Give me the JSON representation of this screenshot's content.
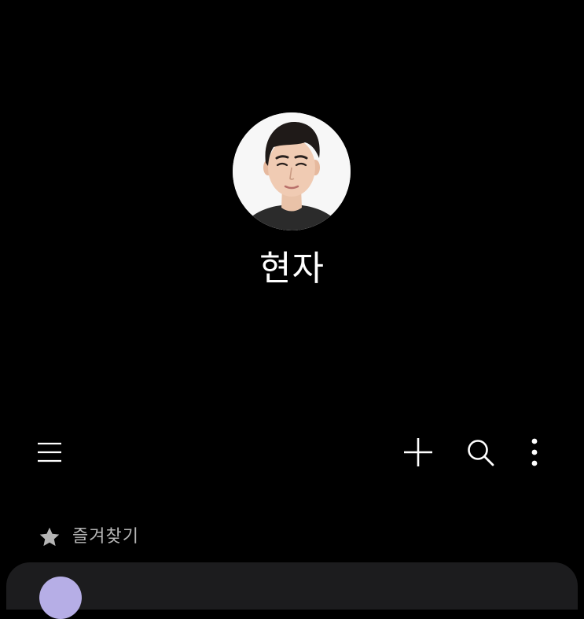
{
  "profile": {
    "name": "현자",
    "avatar_icon": "profile-photo"
  },
  "toolbar": {
    "menu_icon": "hamburger-menu-icon",
    "add_icon": "plus-icon",
    "search_icon": "search-icon",
    "more_icon": "more-vertical-icon"
  },
  "favorites": {
    "section_label": "즐겨찾기",
    "icon": "star-icon"
  },
  "colors": {
    "background": "#000000",
    "text_primary": "#ffffff",
    "text_secondary": "#b5b5b5",
    "card": "#1c1c1e",
    "contact_avatar": "#b6aee6"
  }
}
